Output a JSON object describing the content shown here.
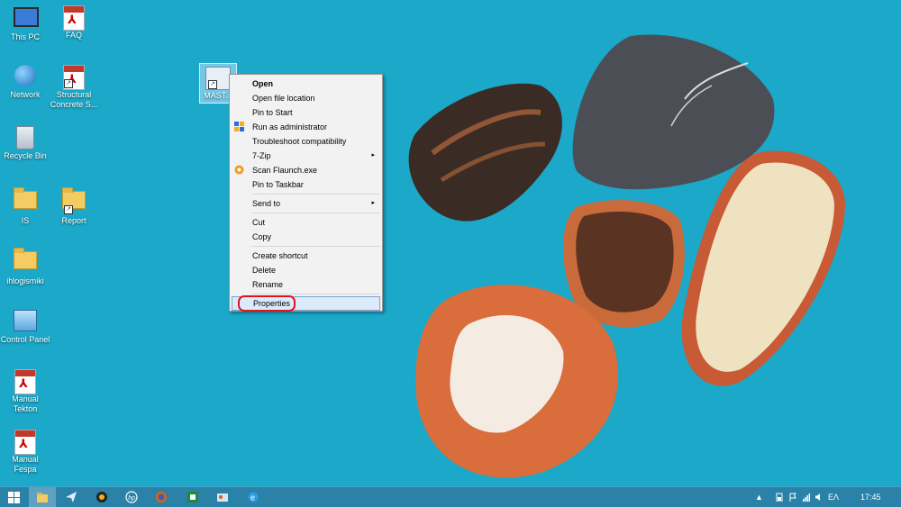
{
  "desktop": {
    "icons": [
      {
        "label": "This PC"
      },
      {
        "label": "FAQ"
      },
      {
        "label": "Network"
      },
      {
        "label": "Structural Concrete S..."
      },
      {
        "label": "Recycle Bin"
      },
      {
        "label": "IS"
      },
      {
        "label": "Report"
      },
      {
        "label": "ihlogismiki"
      },
      {
        "label": "Control Panel"
      },
      {
        "label": "Manual Tekton"
      },
      {
        "label": "Manual Fespa"
      }
    ],
    "selected_label": "MAST..."
  },
  "context_menu": {
    "items": [
      {
        "label": "Open"
      },
      {
        "label": "Open file location"
      },
      {
        "label": "Pin to Start"
      },
      {
        "label": "Run as administrator"
      },
      {
        "label": "Troubleshoot compatibility"
      },
      {
        "label": "7-Zip"
      },
      {
        "label": "Scan Flaunch.exe"
      },
      {
        "label": "Pin to Taskbar"
      },
      {
        "label": "Send to"
      },
      {
        "label": "Cut"
      },
      {
        "label": "Copy"
      },
      {
        "label": "Create shortcut"
      },
      {
        "label": "Delete"
      },
      {
        "label": "Rename"
      },
      {
        "label": "Properties"
      }
    ],
    "submenu_arrow": "▸"
  },
  "taskbar": {
    "language": "ΕΛ",
    "clock": "17:45"
  },
  "colors": {
    "wallpaper": "#1ba8c9",
    "taskbar": "#2a82a8",
    "highlight_circle": "#e0141e"
  }
}
